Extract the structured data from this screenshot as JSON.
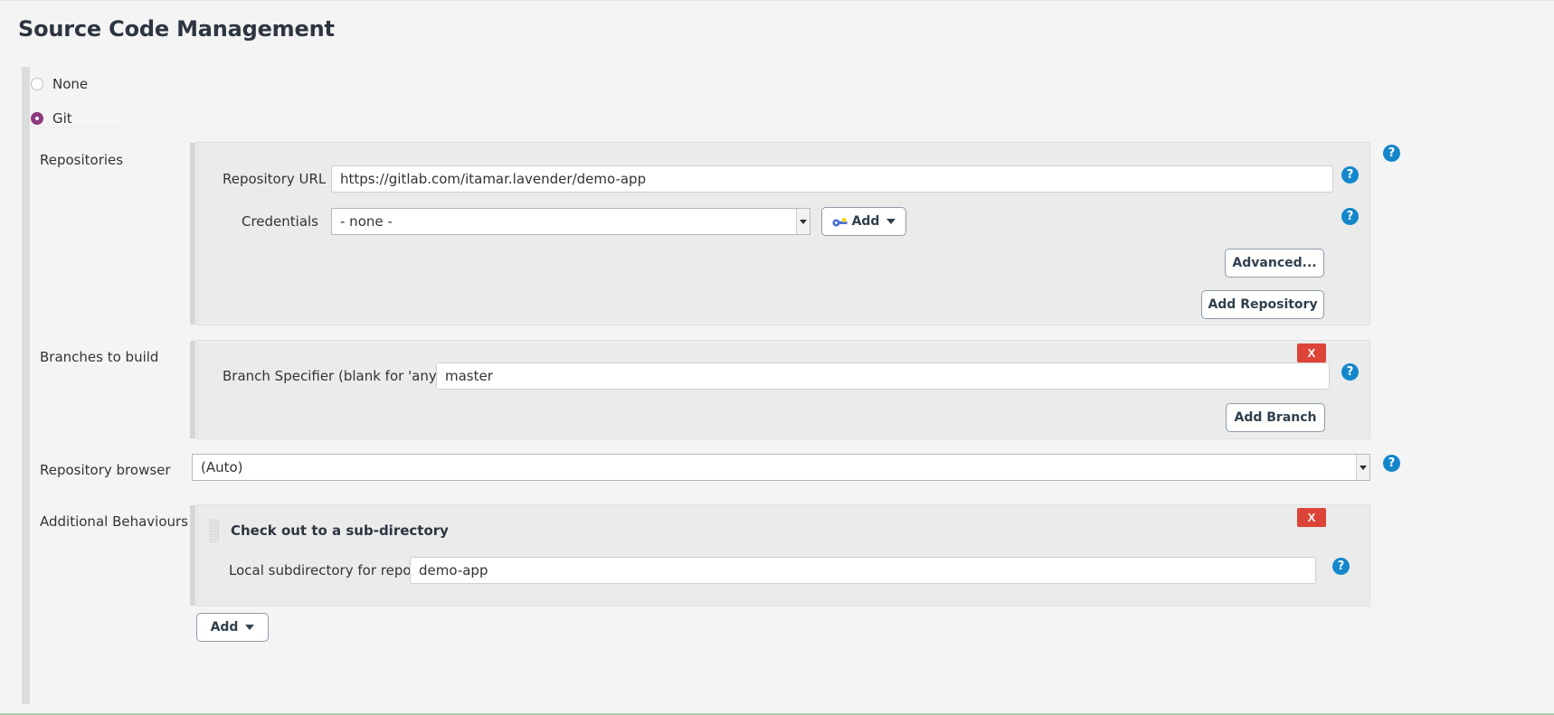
{
  "page": {
    "title": "Source Code Management"
  },
  "scm_options": [
    {
      "label": "None",
      "selected": false
    },
    {
      "label": "Git",
      "selected": true
    }
  ],
  "sections": {
    "repositories": {
      "label": "Repositories",
      "repository_url": {
        "label": "Repository URL",
        "value": "https://gitlab.com/itamar.lavender/demo-app"
      },
      "credentials": {
        "label": "Credentials",
        "value": "- none -",
        "options": [
          "- none -"
        ]
      },
      "add_credentials_button": "Add",
      "advanced_button": "Advanced...",
      "add_repository_button": "Add Repository"
    },
    "branches": {
      "label": "Branches to build",
      "branch_specifier": {
        "label": "Branch Specifier (blank for 'any')",
        "value": "master"
      },
      "delete_button": "X",
      "add_branch_button": "Add Branch"
    },
    "repository_browser": {
      "label": "Repository browser",
      "value": "(Auto)",
      "options": [
        "(Auto)"
      ]
    },
    "additional_behaviours": {
      "label": "Additional Behaviours",
      "behaviour": {
        "title": "Check out to a sub-directory",
        "delete_button": "X",
        "local_subdirectory": {
          "label": "Local subdirectory for repo",
          "value": "demo-app"
        }
      },
      "add_button": "Add"
    }
  },
  "help_icon": "?",
  "colors": {
    "accent_radio": "#8e3a7e",
    "help_blue": "#1487cb",
    "delete_red": "#dc4437",
    "panel_bg": "#ebebeb",
    "page_bg": "#f4f4f4"
  }
}
